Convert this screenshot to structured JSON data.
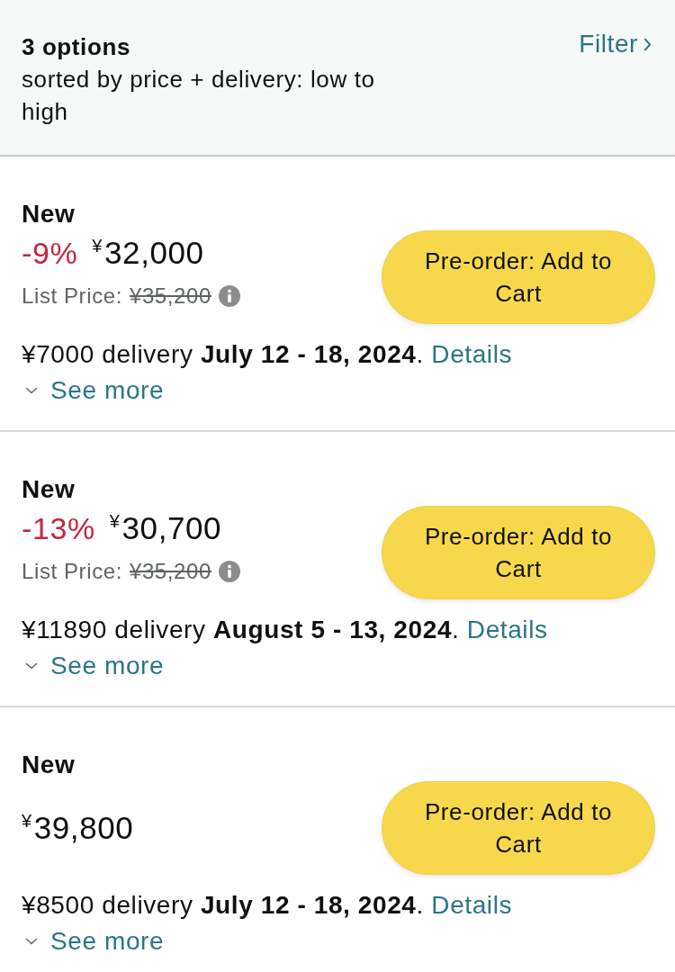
{
  "header": {
    "title": "3 options",
    "subtitle": "sorted by price + delivery: low to high",
    "filter_link": "Filter"
  },
  "offers": [
    {
      "condition": "New",
      "discount": "-9%",
      "price": "$^{¥}$32,000",
      "list_price_label": "List Price:",
      "list_price": "¥35,200",
      "button": "Pre-order: Add to Cart",
      "delivery": "¥7000 delivery **July 12 - 18, 2024**.",
      "details_link": "Details",
      "see_more": "See more"
    },
    {
      "condition": "New",
      "discount": "-13%",
      "price": "$^{¥}$30,700",
      "list_price_label": "List Price:",
      "list_price": "¥35,200",
      "button": "Pre-order: Add to Cart",
      "delivery": "¥11890 delivery **August 5 - 13, 2024**.",
      "details_link": "Details",
      "see_more": "See more"
    },
    {
      "condition": "New",
      "price": "$^{¥}$39,800",
      "button": "Pre-order: Add to Cart",
      "delivery": "¥8500 delivery **July 12 - 18, 2024**.",
      "details_link": "Details",
      "see_more": "See more"
    }
  ]
}
